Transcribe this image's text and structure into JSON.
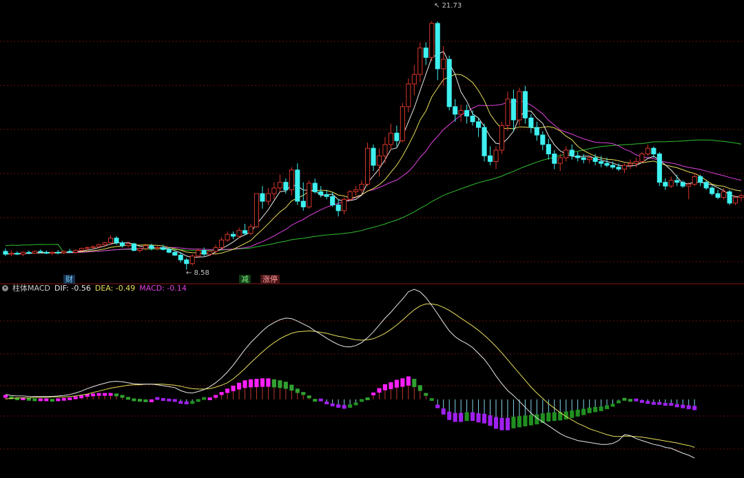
{
  "annotations": {
    "high": "21.73",
    "low": "8.58"
  },
  "event_tags": [
    {
      "text": "财"
    },
    {
      "text": "减"
    },
    {
      "text": "涨停"
    }
  ],
  "macd_legend": {
    "name": "柱体MACD",
    "dif_label": "DIF: -0.56",
    "dea_label": "DEA: -0.49",
    "macd_label": "MACD: -0.14"
  },
  "colors": {
    "up": "#d9362b",
    "down": "#3ff0f0",
    "ma5": "#e8e8e8",
    "ma10": "#e8e05a",
    "ma20": "#e040e0",
    "ma60": "#30c030",
    "macd_pos_strong": "#ff1fff",
    "macd_pos_weak": "#30a030",
    "macd_neg_strong": "#a020f0",
    "macd_neg_weak": "#209020",
    "macd_stem_pos": "#c0392b",
    "macd_stem_neg": "#86d8f0",
    "dif": "#e8e8e8",
    "dea": "#e8e05a",
    "grid": "#6b1111",
    "divider": "#8b1515"
  },
  "chart_data": [
    {
      "type": "candlestick",
      "ylim": [
        8.2,
        22.4
      ],
      "candles": [
        {
          "o": 9.55,
          "h": 9.7,
          "l": 9.3,
          "c": 9.4
        },
        {
          "o": 9.4,
          "h": 9.6,
          "l": 9.3,
          "c": 9.45
        },
        {
          "o": 9.45,
          "h": 9.55,
          "l": 9.35,
          "c": 9.4
        },
        {
          "o": 9.4,
          "h": 9.55,
          "l": 9.3,
          "c": 9.5
        },
        {
          "o": 9.5,
          "h": 9.6,
          "l": 9.4,
          "c": 9.45
        },
        {
          "o": 9.45,
          "h": 9.6,
          "l": 9.4,
          "c": 9.55
        },
        {
          "o": 9.55,
          "h": 9.65,
          "l": 9.45,
          "c": 9.5
        },
        {
          "o": 9.5,
          "h": 9.6,
          "l": 9.4,
          "c": 9.45
        },
        {
          "o": 9.45,
          "h": 9.55,
          "l": 9.35,
          "c": 9.5
        },
        {
          "o": 9.5,
          "h": 9.62,
          "l": 9.4,
          "c": 9.48
        },
        {
          "o": 9.48,
          "h": 9.6,
          "l": 9.4,
          "c": 9.55
        },
        {
          "o": 9.55,
          "h": 9.68,
          "l": 9.45,
          "c": 9.5
        },
        {
          "o": 9.5,
          "h": 9.65,
          "l": 9.45,
          "c": 9.6
        },
        {
          "o": 9.6,
          "h": 9.75,
          "l": 9.55,
          "c": 9.7
        },
        {
          "o": 9.7,
          "h": 9.8,
          "l": 9.6,
          "c": 9.75
        },
        {
          "o": 9.75,
          "h": 9.85,
          "l": 9.65,
          "c": 9.8
        },
        {
          "o": 9.8,
          "h": 9.95,
          "l": 9.7,
          "c": 9.9
        },
        {
          "o": 9.9,
          "h": 10.05,
          "l": 9.8,
          "c": 10.0
        },
        {
          "o": 10.0,
          "h": 10.4,
          "l": 9.9,
          "c": 10.25
        },
        {
          "o": 10.25,
          "h": 10.35,
          "l": 9.9,
          "c": 10.0
        },
        {
          "o": 10.0,
          "h": 10.1,
          "l": 9.75,
          "c": 9.85
        },
        {
          "o": 9.85,
          "h": 10.05,
          "l": 9.75,
          "c": 9.95
        },
        {
          "o": 9.95,
          "h": 10.0,
          "l": 9.55,
          "c": 9.6
        },
        {
          "o": 9.6,
          "h": 9.75,
          "l": 9.5,
          "c": 9.7
        },
        {
          "o": 9.7,
          "h": 9.95,
          "l": 9.6,
          "c": 9.85
        },
        {
          "o": 9.85,
          "h": 9.95,
          "l": 9.6,
          "c": 9.7
        },
        {
          "o": 9.7,
          "h": 9.85,
          "l": 9.6,
          "c": 9.75
        },
        {
          "o": 9.75,
          "h": 9.9,
          "l": 9.6,
          "c": 9.65
        },
        {
          "o": 9.65,
          "h": 9.75,
          "l": 9.45,
          "c": 9.5
        },
        {
          "o": 9.5,
          "h": 9.6,
          "l": 9.3,
          "c": 9.35
        },
        {
          "o": 9.35,
          "h": 9.5,
          "l": 8.95,
          "c": 9.1
        },
        {
          "o": 9.1,
          "h": 9.2,
          "l": 8.58,
          "c": 8.9
        },
        {
          "o": 8.9,
          "h": 9.4,
          "l": 8.8,
          "c": 9.3
        },
        {
          "o": 9.3,
          "h": 9.7,
          "l": 9.2,
          "c": 9.6
        },
        {
          "o": 9.6,
          "h": 9.75,
          "l": 9.3,
          "c": 9.4
        },
        {
          "o": 9.4,
          "h": 9.6,
          "l": 9.3,
          "c": 9.55
        },
        {
          "o": 9.55,
          "h": 9.9,
          "l": 9.45,
          "c": 9.75
        },
        {
          "o": 9.75,
          "h": 10.3,
          "l": 9.65,
          "c": 10.15
        },
        {
          "o": 10.15,
          "h": 10.6,
          "l": 10.05,
          "c": 10.45
        },
        {
          "o": 10.45,
          "h": 10.6,
          "l": 10.2,
          "c": 10.35
        },
        {
          "o": 10.35,
          "h": 10.8,
          "l": 10.25,
          "c": 10.65
        },
        {
          "o": 10.65,
          "h": 11.0,
          "l": 10.4,
          "c": 10.5
        },
        {
          "o": 10.5,
          "h": 11.0,
          "l": 10.4,
          "c": 10.85
        },
        {
          "o": 10.85,
          "h": 12.6,
          "l": 10.8,
          "c": 12.6
        },
        {
          "o": 12.6,
          "h": 13.0,
          "l": 11.8,
          "c": 12.2
        },
        {
          "o": 12.2,
          "h": 12.9,
          "l": 12.0,
          "c": 12.6
        },
        {
          "o": 12.6,
          "h": 13.2,
          "l": 12.3,
          "c": 12.9
        },
        {
          "o": 12.9,
          "h": 13.6,
          "l": 12.7,
          "c": 13.2
        },
        {
          "o": 13.2,
          "h": 13.4,
          "l": 12.6,
          "c": 12.8
        },
        {
          "o": 12.8,
          "h": 14.0,
          "l": 12.5,
          "c": 13.85
        },
        {
          "o": 13.85,
          "h": 14.2,
          "l": 12.0,
          "c": 12.2
        },
        {
          "o": 12.2,
          "h": 13.2,
          "l": 11.7,
          "c": 11.9
        },
        {
          "o": 11.9,
          "h": 13.3,
          "l": 11.8,
          "c": 13.15
        },
        {
          "o": 13.15,
          "h": 13.4,
          "l": 12.6,
          "c": 12.7
        },
        {
          "o": 12.7,
          "h": 13.0,
          "l": 12.4,
          "c": 12.55
        },
        {
          "o": 12.55,
          "h": 12.8,
          "l": 12.3,
          "c": 12.45
        },
        {
          "o": 12.45,
          "h": 12.7,
          "l": 11.9,
          "c": 12.0
        },
        {
          "o": 12.0,
          "h": 12.3,
          "l": 11.4,
          "c": 11.7
        },
        {
          "o": 11.7,
          "h": 12.4,
          "l": 11.5,
          "c": 12.3
        },
        {
          "o": 12.3,
          "h": 12.8,
          "l": 12.2,
          "c": 12.7
        },
        {
          "o": 12.7,
          "h": 13.0,
          "l": 12.5,
          "c": 12.8
        },
        {
          "o": 12.8,
          "h": 13.3,
          "l": 12.6,
          "c": 13.1
        },
        {
          "o": 13.1,
          "h": 15.3,
          "l": 13.0,
          "c": 15.0
        },
        {
          "o": 15.0,
          "h": 15.2,
          "l": 13.8,
          "c": 14.1
        },
        {
          "o": 14.1,
          "h": 15.0,
          "l": 13.5,
          "c": 14.6
        },
        {
          "o": 14.6,
          "h": 15.6,
          "l": 14.2,
          "c": 15.2
        },
        {
          "o": 15.2,
          "h": 16.3,
          "l": 14.9,
          "c": 15.8
        },
        {
          "o": 15.8,
          "h": 16.2,
          "l": 15.1,
          "c": 15.4
        },
        {
          "o": 15.4,
          "h": 17.4,
          "l": 15.3,
          "c": 17.2
        },
        {
          "o": 17.2,
          "h": 18.7,
          "l": 16.9,
          "c": 18.4
        },
        {
          "o": 18.4,
          "h": 19.4,
          "l": 17.8,
          "c": 18.9
        },
        {
          "o": 18.9,
          "h": 20.6,
          "l": 18.5,
          "c": 20.3
        },
        {
          "o": 20.3,
          "h": 20.6,
          "l": 19.4,
          "c": 19.8
        },
        {
          "o": 19.8,
          "h": 21.73,
          "l": 19.6,
          "c": 21.6
        },
        {
          "o": 21.6,
          "h": 21.7,
          "l": 18.6,
          "c": 19.2
        },
        {
          "o": 19.2,
          "h": 20.4,
          "l": 18.3,
          "c": 19.7
        },
        {
          "o": 19.7,
          "h": 19.9,
          "l": 17.0,
          "c": 17.2
        },
        {
          "o": 17.2,
          "h": 17.6,
          "l": 16.4,
          "c": 16.8
        },
        {
          "o": 16.8,
          "h": 17.3,
          "l": 16.4,
          "c": 17.0
        },
        {
          "o": 17.0,
          "h": 17.3,
          "l": 16.3,
          "c": 16.7
        },
        {
          "o": 16.7,
          "h": 17.0,
          "l": 16.2,
          "c": 16.4
        },
        {
          "o": 16.4,
          "h": 16.6,
          "l": 15.6,
          "c": 16.1
        },
        {
          "o": 16.1,
          "h": 16.3,
          "l": 14.3,
          "c": 14.6
        },
        {
          "o": 14.6,
          "h": 15.1,
          "l": 14.1,
          "c": 14.3
        },
        {
          "o": 14.3,
          "h": 15.1,
          "l": 13.9,
          "c": 14.9
        },
        {
          "o": 14.9,
          "h": 16.4,
          "l": 14.7,
          "c": 16.2
        },
        {
          "o": 16.2,
          "h": 18.0,
          "l": 15.9,
          "c": 17.6
        },
        {
          "o": 17.6,
          "h": 18.1,
          "l": 15.9,
          "c": 16.5
        },
        {
          "o": 16.5,
          "h": 18.2,
          "l": 16.2,
          "c": 18.0
        },
        {
          "o": 18.0,
          "h": 18.3,
          "l": 16.3,
          "c": 16.6
        },
        {
          "o": 16.6,
          "h": 16.8,
          "l": 15.8,
          "c": 16.1
        },
        {
          "o": 16.1,
          "h": 16.4,
          "l": 15.4,
          "c": 15.7
        },
        {
          "o": 15.7,
          "h": 15.9,
          "l": 14.9,
          "c": 15.2
        },
        {
          "o": 15.2,
          "h": 15.5,
          "l": 14.4,
          "c": 14.7
        },
        {
          "o": 14.7,
          "h": 14.9,
          "l": 13.9,
          "c": 14.2
        },
        {
          "o": 14.2,
          "h": 14.7,
          "l": 13.8,
          "c": 14.5
        },
        {
          "o": 14.5,
          "h": 15.1,
          "l": 14.3,
          "c": 14.9
        },
        {
          "o": 14.9,
          "h": 15.2,
          "l": 14.4,
          "c": 14.6
        },
        {
          "o": 14.6,
          "h": 14.8,
          "l": 14.3,
          "c": 14.5
        },
        {
          "o": 14.5,
          "h": 14.7,
          "l": 14.2,
          "c": 14.4
        },
        {
          "o": 14.4,
          "h": 14.6,
          "l": 14.2,
          "c": 14.5
        },
        {
          "o": 14.5,
          "h": 14.7,
          "l": 14.1,
          "c": 14.3
        },
        {
          "o": 14.3,
          "h": 14.6,
          "l": 14.0,
          "c": 14.2
        },
        {
          "o": 14.2,
          "h": 14.5,
          "l": 14.0,
          "c": 14.1
        },
        {
          "o": 14.1,
          "h": 14.3,
          "l": 13.9,
          "c": 14.0
        },
        {
          "o": 14.0,
          "h": 14.2,
          "l": 13.8,
          "c": 13.9
        },
        {
          "o": 13.9,
          "h": 14.2,
          "l": 13.7,
          "c": 14.1
        },
        {
          "o": 14.1,
          "h": 14.4,
          "l": 13.9,
          "c": 14.2
        },
        {
          "o": 14.2,
          "h": 14.5,
          "l": 14.0,
          "c": 14.3
        },
        {
          "o": 14.3,
          "h": 14.8,
          "l": 14.2,
          "c": 14.7
        },
        {
          "o": 14.7,
          "h": 15.2,
          "l": 14.6,
          "c": 15.0
        },
        {
          "o": 15.0,
          "h": 15.1,
          "l": 14.5,
          "c": 14.7
        },
        {
          "o": 14.7,
          "h": 14.8,
          "l": 13.0,
          "c": 13.2
        },
        {
          "o": 13.2,
          "h": 13.4,
          "l": 12.8,
          "c": 13.0
        },
        {
          "o": 13.0,
          "h": 13.5,
          "l": 12.9,
          "c": 13.3
        },
        {
          "o": 13.3,
          "h": 13.6,
          "l": 13.0,
          "c": 13.2
        },
        {
          "o": 13.2,
          "h": 13.3,
          "l": 12.9,
          "c": 13.0
        },
        {
          "o": 13.0,
          "h": 13.2,
          "l": 12.3,
          "c": 13.1
        },
        {
          "o": 13.1,
          "h": 13.7,
          "l": 13.0,
          "c": 13.5
        },
        {
          "o": 13.5,
          "h": 13.6,
          "l": 13.0,
          "c": 13.2
        },
        {
          "o": 13.2,
          "h": 13.3,
          "l": 12.8,
          "c": 12.9
        },
        {
          "o": 12.9,
          "h": 13.0,
          "l": 12.5,
          "c": 12.6
        },
        {
          "o": 12.6,
          "h": 12.8,
          "l": 12.3,
          "c": 12.4
        },
        {
          "o": 12.4,
          "h": 12.9,
          "l": 12.3,
          "c": 12.7
        },
        {
          "o": 12.7,
          "h": 12.8,
          "l": 12.0,
          "c": 12.1
        },
        {
          "o": 12.1,
          "h": 12.5,
          "l": 12.0,
          "c": 12.4
        },
        {
          "o": 12.4,
          "h": 12.6,
          "l": 12.2,
          "c": 12.5
        }
      ]
    },
    {
      "type": "bar",
      "indicator": "MACD",
      "ylim": [
        -1.55,
        2.25
      ],
      "dif": [
        0.1,
        0.08,
        0.07,
        0.07,
        0.06,
        0.06,
        0.06,
        0.06,
        0.06,
        0.07,
        0.08,
        0.1,
        0.13,
        0.17,
        0.22,
        0.26,
        0.3,
        0.33,
        0.36,
        0.37,
        0.36,
        0.34,
        0.32,
        0.31,
        0.31,
        0.31,
        0.3,
        0.28,
        0.26,
        0.24,
        0.18,
        0.14,
        0.13,
        0.16,
        0.2,
        0.26,
        0.34,
        0.44,
        0.56,
        0.7,
        0.86,
        1.02,
        1.16,
        1.28,
        1.4,
        1.5,
        1.57,
        1.63,
        1.66,
        1.65,
        1.6,
        1.54,
        1.48,
        1.4,
        1.33,
        1.25,
        1.18,
        1.12,
        1.08,
        1.07,
        1.1,
        1.16,
        1.26,
        1.38,
        1.52,
        1.66,
        1.78,
        1.92,
        2.05,
        2.2,
        2.25,
        2.2,
        2.08,
        1.92,
        1.75,
        1.57,
        1.4,
        1.28,
        1.2,
        1.14,
        1.06,
        0.94,
        0.82,
        0.66,
        0.48,
        0.32,
        0.18,
        0.08,
        -0.04,
        -0.16,
        -0.28,
        -0.38,
        -0.46,
        -0.54,
        -0.62,
        -0.7,
        -0.76,
        -0.8,
        -0.84,
        -0.86,
        -0.88,
        -0.9,
        -0.92,
        -0.92,
        -0.9,
        -0.84,
        -0.72,
        -0.74,
        -0.8,
        -0.84,
        -0.88,
        -0.92,
        -0.94,
        -0.98,
        -1.0,
        -1.05,
        -1.1,
        -1.14,
        -1.2
      ],
      "dea": [
        0.01,
        0.02,
        0.03,
        0.03,
        0.03,
        0.04,
        0.04,
        0.04,
        0.05,
        0.05,
        0.05,
        0.06,
        0.07,
        0.09,
        0.11,
        0.14,
        0.17,
        0.2,
        0.23,
        0.25,
        0.27,
        0.29,
        0.3,
        0.3,
        0.31,
        0.31,
        0.31,
        0.31,
        0.3,
        0.29,
        0.27,
        0.24,
        0.22,
        0.21,
        0.21,
        0.22,
        0.25,
        0.29,
        0.34,
        0.42,
        0.52,
        0.63,
        0.75,
        0.86,
        0.97,
        1.07,
        1.16,
        1.24,
        1.3,
        1.35,
        1.38,
        1.39,
        1.4,
        1.39,
        1.37,
        1.35,
        1.32,
        1.29,
        1.27,
        1.24,
        1.22,
        1.21,
        1.22,
        1.24,
        1.29,
        1.35,
        1.43,
        1.52,
        1.62,
        1.73,
        1.83,
        1.91,
        1.95,
        1.95,
        1.93,
        1.88,
        1.82,
        1.74,
        1.66,
        1.58,
        1.5,
        1.41,
        1.31,
        1.2,
        1.08,
        0.95,
        0.81,
        0.67,
        0.53,
        0.39,
        0.25,
        0.13,
        0.02,
        -0.09,
        -0.18,
        -0.27,
        -0.35,
        -0.42,
        -0.49,
        -0.54,
        -0.6,
        -0.64,
        -0.68,
        -0.72,
        -0.75,
        -0.76,
        -0.75,
        -0.75,
        -0.76,
        -0.77,
        -0.79,
        -0.81,
        -0.83,
        -0.85,
        -0.87,
        -0.89,
        -0.92,
        -0.94,
        -0.98
      ],
      "macd": [
        0.09,
        0.06,
        0.04,
        0.04,
        0.03,
        0.02,
        0.02,
        0.02,
        0.01,
        0.02,
        0.03,
        0.04,
        0.06,
        0.08,
        0.11,
        0.12,
        0.13,
        0.13,
        0.13,
        0.12,
        0.09,
        0.05,
        0.02,
        0.01,
        0.0,
        0.0,
        -0.01,
        -0.03,
        -0.04,
        -0.05,
        -0.09,
        -0.1,
        -0.09,
        -0.05,
        -0.01,
        0.04,
        0.09,
        0.15,
        0.22,
        0.28,
        0.34,
        0.39,
        0.41,
        0.42,
        0.43,
        0.43,
        0.41,
        0.39,
        0.36,
        0.3,
        0.22,
        0.15,
        0.08,
        0.01,
        -0.04,
        -0.1,
        -0.14,
        -0.17,
        -0.19,
        -0.17,
        -0.12,
        -0.05,
        0.04,
        0.14,
        0.23,
        0.31,
        0.35,
        0.4,
        0.43,
        0.47,
        0.42,
        0.29,
        0.13,
        -0.03,
        -0.18,
        -0.31,
        -0.42,
        -0.46,
        -0.46,
        -0.44,
        -0.44,
        -0.47,
        -0.49,
        -0.54,
        -0.6,
        -0.63,
        -0.63,
        -0.59,
        -0.57,
        -0.55,
        -0.53,
        -0.51,
        -0.48,
        -0.45,
        -0.44,
        -0.43,
        -0.41,
        -0.38,
        -0.35,
        -0.32,
        -0.28,
        -0.26,
        -0.24,
        -0.2,
        -0.15,
        -0.08,
        0.03,
        0.01,
        -0.04,
        -0.07,
        -0.09,
        -0.11,
        -0.11,
        -0.13,
        -0.13,
        -0.16,
        -0.18,
        -0.2,
        -0.22
      ]
    }
  ]
}
